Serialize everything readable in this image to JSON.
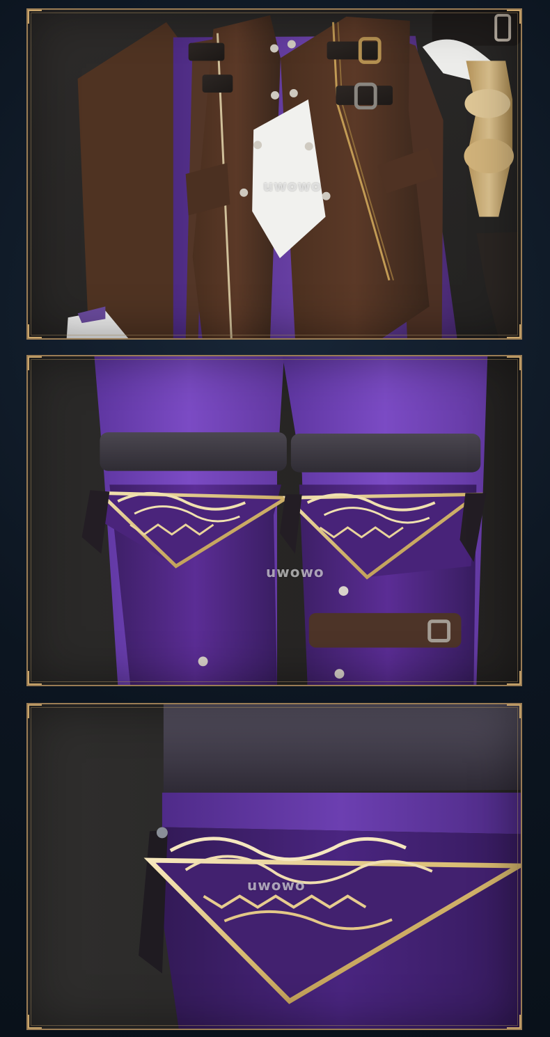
{
  "page": {
    "background_color": "#0d1620",
    "frame_color": "#9b7d55"
  },
  "panels": [
    {
      "name": "jacket-vest-panel",
      "watermark": "uwowo"
    },
    {
      "name": "pants-strap-panel",
      "watermark": "uwowo"
    },
    {
      "name": "hem-detail-panel",
      "watermark": "uwowo"
    }
  ]
}
